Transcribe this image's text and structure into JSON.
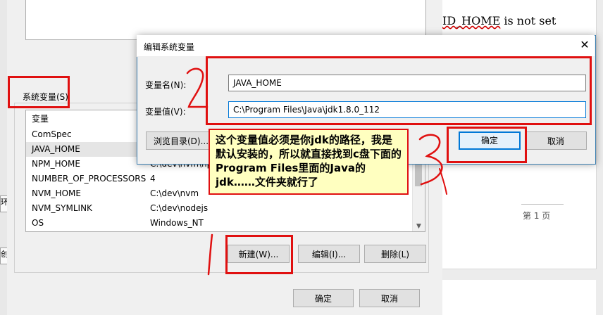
{
  "left_strip": {
    "fragments": [
      "环",
      "创"
    ]
  },
  "env_dialog": {
    "system_vars_label": "系统变量(S)",
    "table_headers": {
      "name": "变量",
      "value": ""
    },
    "rows": [
      {
        "name": "ComSpec",
        "value": ""
      },
      {
        "name": "JAVA_HOME",
        "value": ""
      },
      {
        "name": "NPM_HOME",
        "value": "C:\\dev\\nvm\\np"
      },
      {
        "name": "NUMBER_OF_PROCESSORS",
        "value": "4"
      },
      {
        "name": "NVM_HOME",
        "value": "C:\\dev\\nvm"
      },
      {
        "name": "NVM_SYMLINK",
        "value": "C:\\dev\\nodejs"
      },
      {
        "name": "OS",
        "value": "Windows_NT"
      }
    ],
    "new_button": "新建(W)...",
    "edit_button": "编辑(I)...",
    "delete_button": "删除(L)",
    "ok_button": "确定",
    "cancel_button": "取消"
  },
  "document": {
    "text": "ID_HOME is not set",
    "text_prefix": "ID_HOME",
    "text_suffix": " is not set",
    "page_label": "第 1 页"
  },
  "edit_dialog": {
    "title": "编辑系统变量",
    "name_label": "变量名(N):",
    "name_value": "JAVA_HOME",
    "value_label": "变量值(V):",
    "value_value": "C:\\Program Files\\Java\\jdk1.8.0_112",
    "browse_button": "浏览目录(D)...",
    "ok_button": "确定",
    "cancel_button": "取消"
  },
  "annotation": {
    "note": "这个变量值必须是你jdk的路径，我是默认安装的，所以就直接找到c盘下面的Program Files里面的Java的jdk……文件夹就行了",
    "markers": [
      "1",
      "2",
      "3"
    ],
    "color": "#e01010"
  },
  "colors": {
    "accent": "#0078d7",
    "annotation_red": "#e01010",
    "note_bg": "#ffffc0"
  }
}
